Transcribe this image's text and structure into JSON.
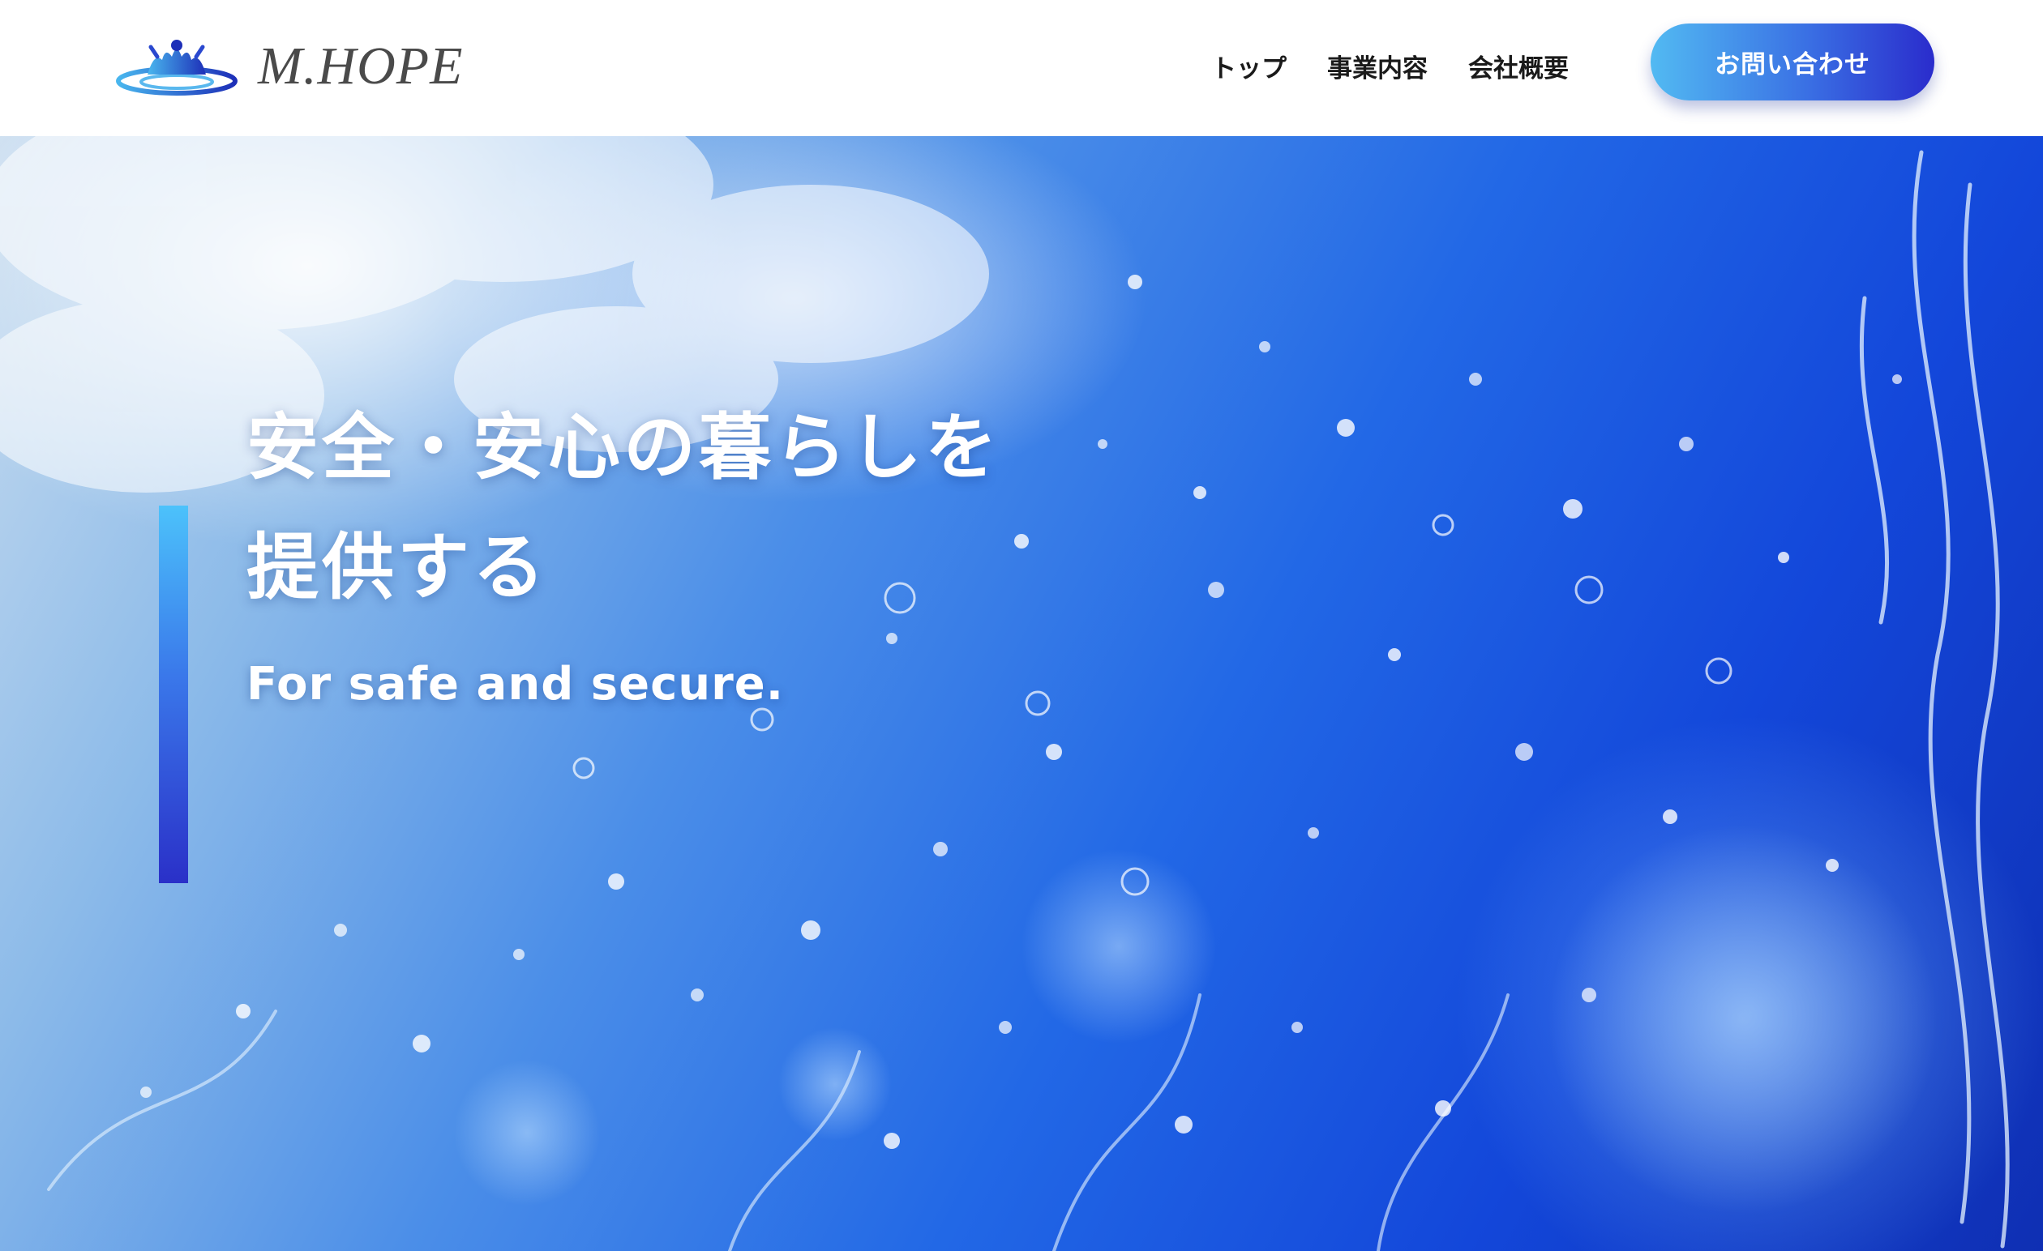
{
  "header": {
    "logo_text": "M.HOPE",
    "nav": [
      {
        "label": "トップ"
      },
      {
        "label": "事業内容"
      },
      {
        "label": "会社概要"
      }
    ],
    "contact_label": "お問い合わせ"
  },
  "hero": {
    "headline_line1": "安全・安心の暮らしを",
    "headline_line2": "提供する",
    "subline": "For safe and secure.",
    "background": "water-splash-image"
  },
  "colors": {
    "accent_light": "#4cc2fb",
    "accent_mid": "#3a78ea",
    "accent_dark": "#2a2ccc",
    "nav_text": "#1a1a1a",
    "logo_text": "#4a4a4a"
  }
}
